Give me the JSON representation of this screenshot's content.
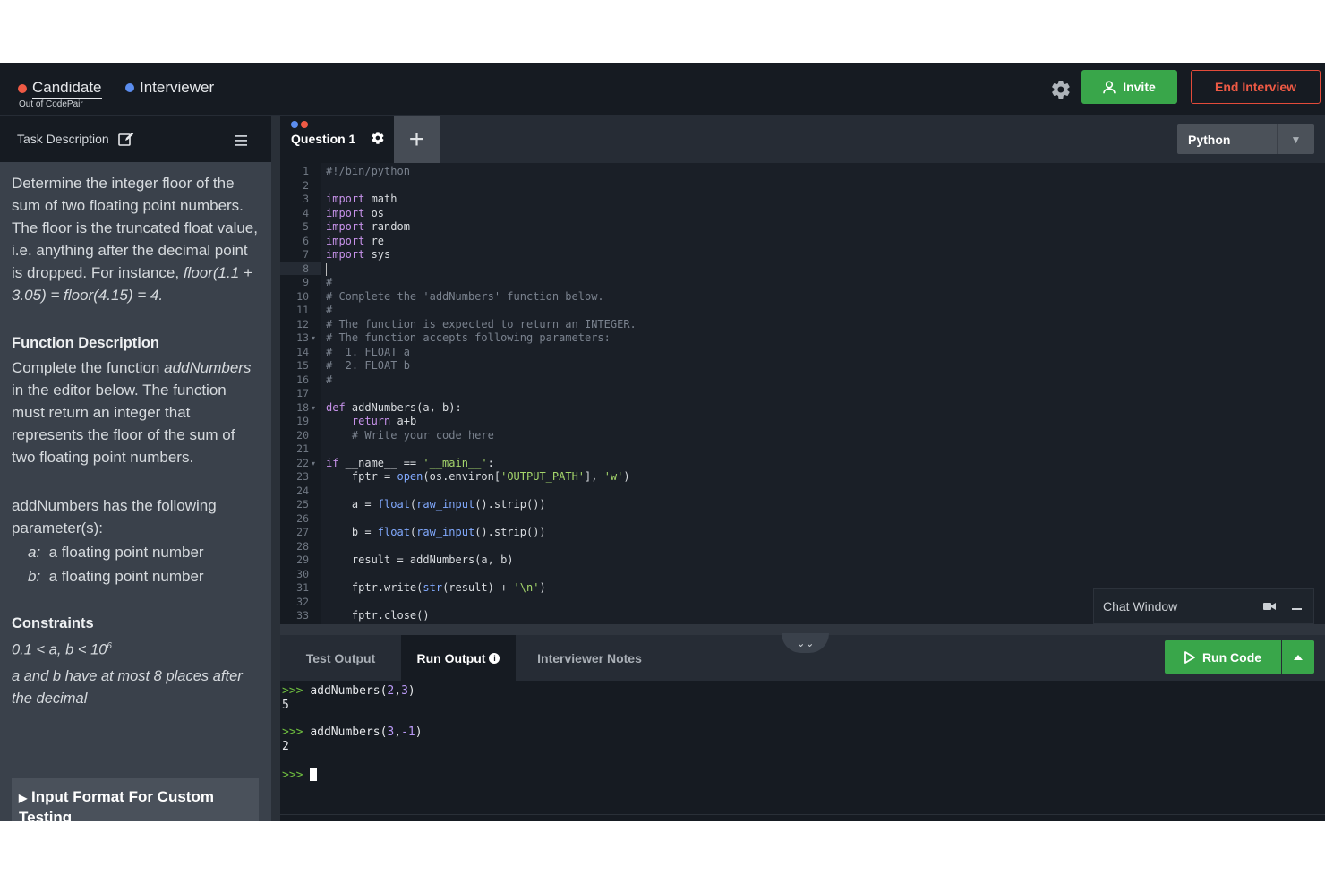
{
  "header": {
    "candidate_label": "Candidate",
    "candidate_sub": "Out of CodePair",
    "interviewer_label": "Interviewer",
    "invite_label": "Invite",
    "end_label": "End Interview",
    "colors": {
      "candidate_dot": "#ef5a45",
      "interviewer_dot": "#5b8def",
      "invite_bg": "#39a64a",
      "end_border": "#e34b3a"
    }
  },
  "left_panel": {
    "title": "Task Description",
    "intro": "Determine the integer floor of the sum of two floating point numbers. The floor is the truncated float value, i.e. anything after the decimal point is dropped. For instance, ",
    "intro_example": "floor(1.1 + 3.05) = floor(4.15) = 4.",
    "function_heading": "Function Description",
    "function_pre": "Complete the function ",
    "function_name": "addNumbers",
    "function_post": " in the editor below. The function must return an integer that represents the floor of the sum of two floating point numbers.",
    "params_intro": "addNumbers has the following parameter(s):",
    "params": [
      {
        "name": "a:",
        "desc": "a floating point number"
      },
      {
        "name": "b:",
        "desc": "a floating point number"
      }
    ],
    "constraints_heading": "Constraints",
    "constraint_1": "0.1 < a, b < 10",
    "constraint_1_exp": "6",
    "constraint_2": "a and b have at most 8 places after the decimal",
    "expander_label": "Input Format For Custom Testing"
  },
  "editor": {
    "tab_label": "Question 1",
    "language": "Python",
    "lines": [
      "#!/bin/python",
      "",
      "import math",
      "import os",
      "import random",
      "import re",
      "import sys",
      "",
      "#",
      "# Complete the 'addNumbers' function below.",
      "#",
      "# The function is expected to return an INTEGER.",
      "# The function accepts following parameters:",
      "#  1. FLOAT a",
      "#  2. FLOAT b",
      "#",
      "",
      "def addNumbers(a, b):",
      "    return a+b",
      "    # Write your code here",
      "",
      "if __name__ == '__main__':",
      "    fptr = open(os.environ['OUTPUT_PATH'], 'w')",
      "",
      "    a = float(raw_input().strip())",
      "",
      "    b = float(raw_input().strip())",
      "",
      "    result = addNumbers(a, b)",
      "",
      "    fptr.write(str(result) + '\\n')",
      "",
      "    fptr.close()"
    ],
    "active_line": 8
  },
  "chat": {
    "label": "Chat Window"
  },
  "output": {
    "tabs": [
      "Test Output",
      "Run Output",
      "Interviewer Notes"
    ],
    "active_tab": "Run Output",
    "run_label": "Run Code",
    "console": [
      {
        "prompt": ">>>",
        "call": "addNumbers",
        "args": [
          "2",
          "3"
        ],
        "result": "5"
      },
      {
        "prompt": ">>>",
        "call": "addNumbers",
        "args": [
          "3",
          "-1"
        ],
        "result": "2"
      }
    ],
    "final_prompt": ">>>"
  }
}
